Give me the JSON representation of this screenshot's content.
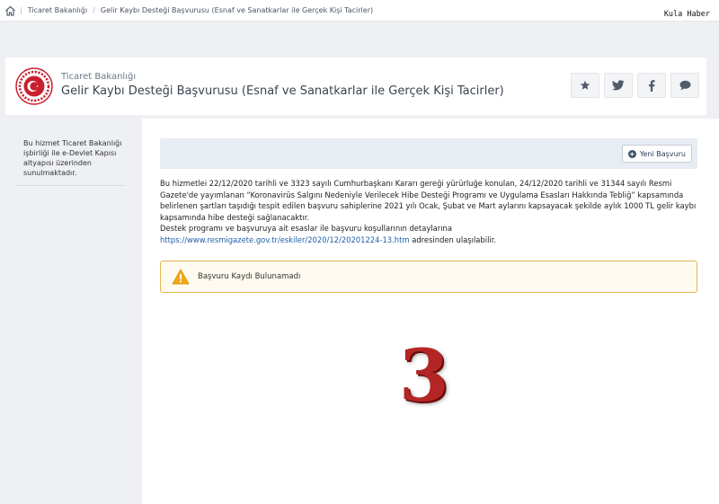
{
  "breadcrumb": {
    "items": [
      "Ticaret Bakanlığı",
      "Gelir Kaybı Desteği Başvurusu (Esnaf ve Sanatkarlar ile Gerçek Kişi Tacirler)"
    ]
  },
  "watermark": "Kula Haber",
  "header": {
    "institution": "Ticaret Bakanlığı",
    "title": "Gelir Kaybı Desteği Başvurusu (Esnaf ve Sanatkarlar ile Gerçek Kişi Tacirler)"
  },
  "sidebar": {
    "text": "Bu hizmet Ticaret Bakanlığı işbirliği ile e-Devlet Kapısı altyapısı üzerinden sunulmaktadır."
  },
  "toolbar": {
    "new_label": "Yeni Başvuru"
  },
  "description": {
    "para1": "Bu hizmetlei 22/12/2020 tarihli ve 3323 sayılı Cumhurbaşkanı Kararı gereği yürürluğe konulan, 24/12/2020 tarihli ve 31344 sayılı Resmi Gazete'de yayımlanan “Koronavirüs Salgını Nedeniyle Verilecek Hibe Desteği Programı ve Uygulama Esasları Hakkında Tebliğ” kapsamında belirlenen şartları taşıdığı tespit edilen başvuru sahiplerine 2021 yılı Ocak, Şubat ve Mart aylarını kapsayacak şekilde aylık 1000 TL gelir kaybı kapsamında hibe desteği sağlanacaktır.",
    "para2": "Destek programı ve başvuruya ait esaslar ile başvuru koşullarının detaylarına",
    "link": "https://www.resmigazete.gov.tr/eskiler/2020/12/20201224-13.htm",
    "suffix": " adresinden ulaşılabilir."
  },
  "alert": {
    "message": "Başvuru Kaydı Bulunamadı"
  },
  "overlay_number": "3",
  "colors": {
    "accent": "#1f5fa9",
    "warning_border": "#e2b84f",
    "overlay": "#b42525",
    "logo_red": "#c8202f"
  }
}
